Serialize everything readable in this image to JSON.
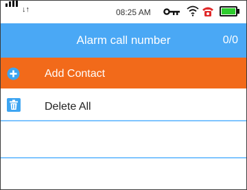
{
  "status_bar": {
    "time": "08:25 AM",
    "data_indicator": "↓↑",
    "icons": [
      "signal-icon",
      "data-arrows-icon",
      "key-icon",
      "wifi-icon",
      "alarm-icon",
      "battery-icon"
    ],
    "battery_level": 1.0,
    "battery_color": "#2ecc2e"
  },
  "header": {
    "title": "Alarm call number",
    "count": "0/0",
    "background": "#4aa8f5"
  },
  "menu": {
    "add_contact": {
      "label": "Add Contact",
      "icon": "plus-circle-icon",
      "background": "#f26a1a"
    },
    "delete_all": {
      "label": "Delete All",
      "icon": "trash-icon"
    }
  },
  "divider_color": "#7ec4ff"
}
